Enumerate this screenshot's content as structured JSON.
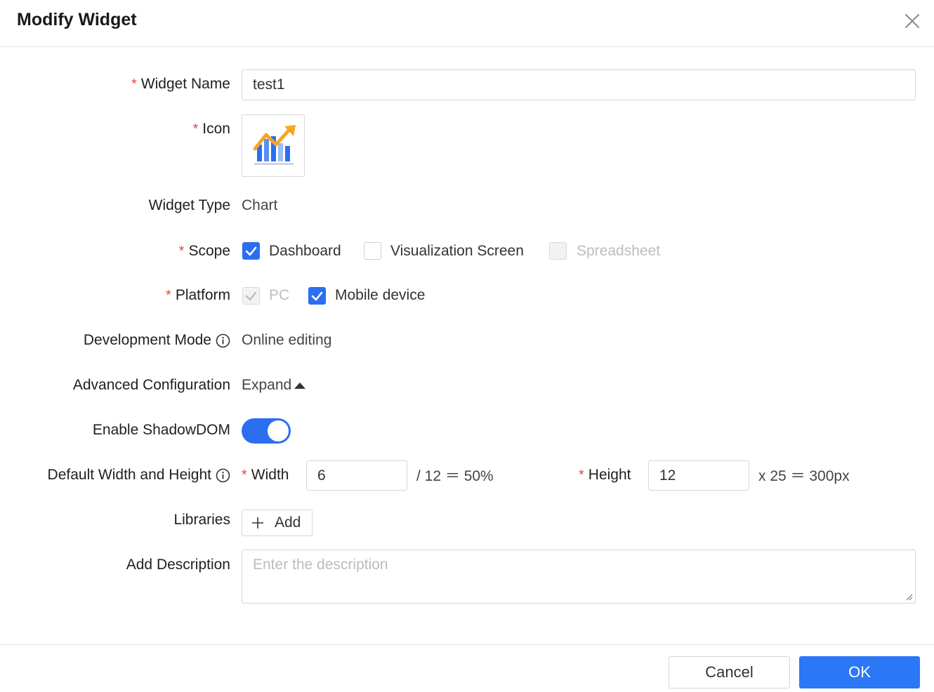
{
  "dialog": {
    "title": "Modify Widget"
  },
  "fields": {
    "widget_name": {
      "label": "Widget Name",
      "value": "test1"
    },
    "icon": {
      "label": "Icon",
      "icon_name": "bar-chart-trend-icon"
    },
    "widget_type": {
      "label": "Widget Type",
      "value": "Chart"
    },
    "scope": {
      "label": "Scope",
      "options": [
        {
          "label": "Dashboard",
          "checked": true,
          "disabled": false
        },
        {
          "label": "Visualization Screen",
          "checked": false,
          "disabled": false
        },
        {
          "label": "Spreadsheet",
          "checked": false,
          "disabled": true
        }
      ]
    },
    "platform": {
      "label": "Platform",
      "options": [
        {
          "label": "PC",
          "checked": true,
          "disabled": true
        },
        {
          "label": "Mobile device",
          "checked": true,
          "disabled": false
        }
      ]
    },
    "development_mode": {
      "label": "Development Mode",
      "value": "Online editing"
    },
    "advanced_configuration": {
      "label": "Advanced Configuration",
      "value": "Expand"
    },
    "shadow_dom": {
      "label": "Enable ShadowDOM",
      "enabled": true
    },
    "default_size": {
      "label": "Default Width and Height",
      "width_label": "Width",
      "width_value": "6",
      "width_suffix": "/ 12 ＝ 50%",
      "height_label": "Height",
      "height_value": "12",
      "height_suffix": "x 25 ＝ 300px"
    },
    "libraries": {
      "label": "Libraries",
      "add_label": "Add"
    },
    "description": {
      "label": "Add Description",
      "placeholder": "Enter the description"
    }
  },
  "footer": {
    "cancel_label": "Cancel",
    "ok_label": "OK"
  },
  "colors": {
    "primary": "#2b6ff0",
    "required": "#e8473f",
    "icon_orange": "#f5a623"
  }
}
